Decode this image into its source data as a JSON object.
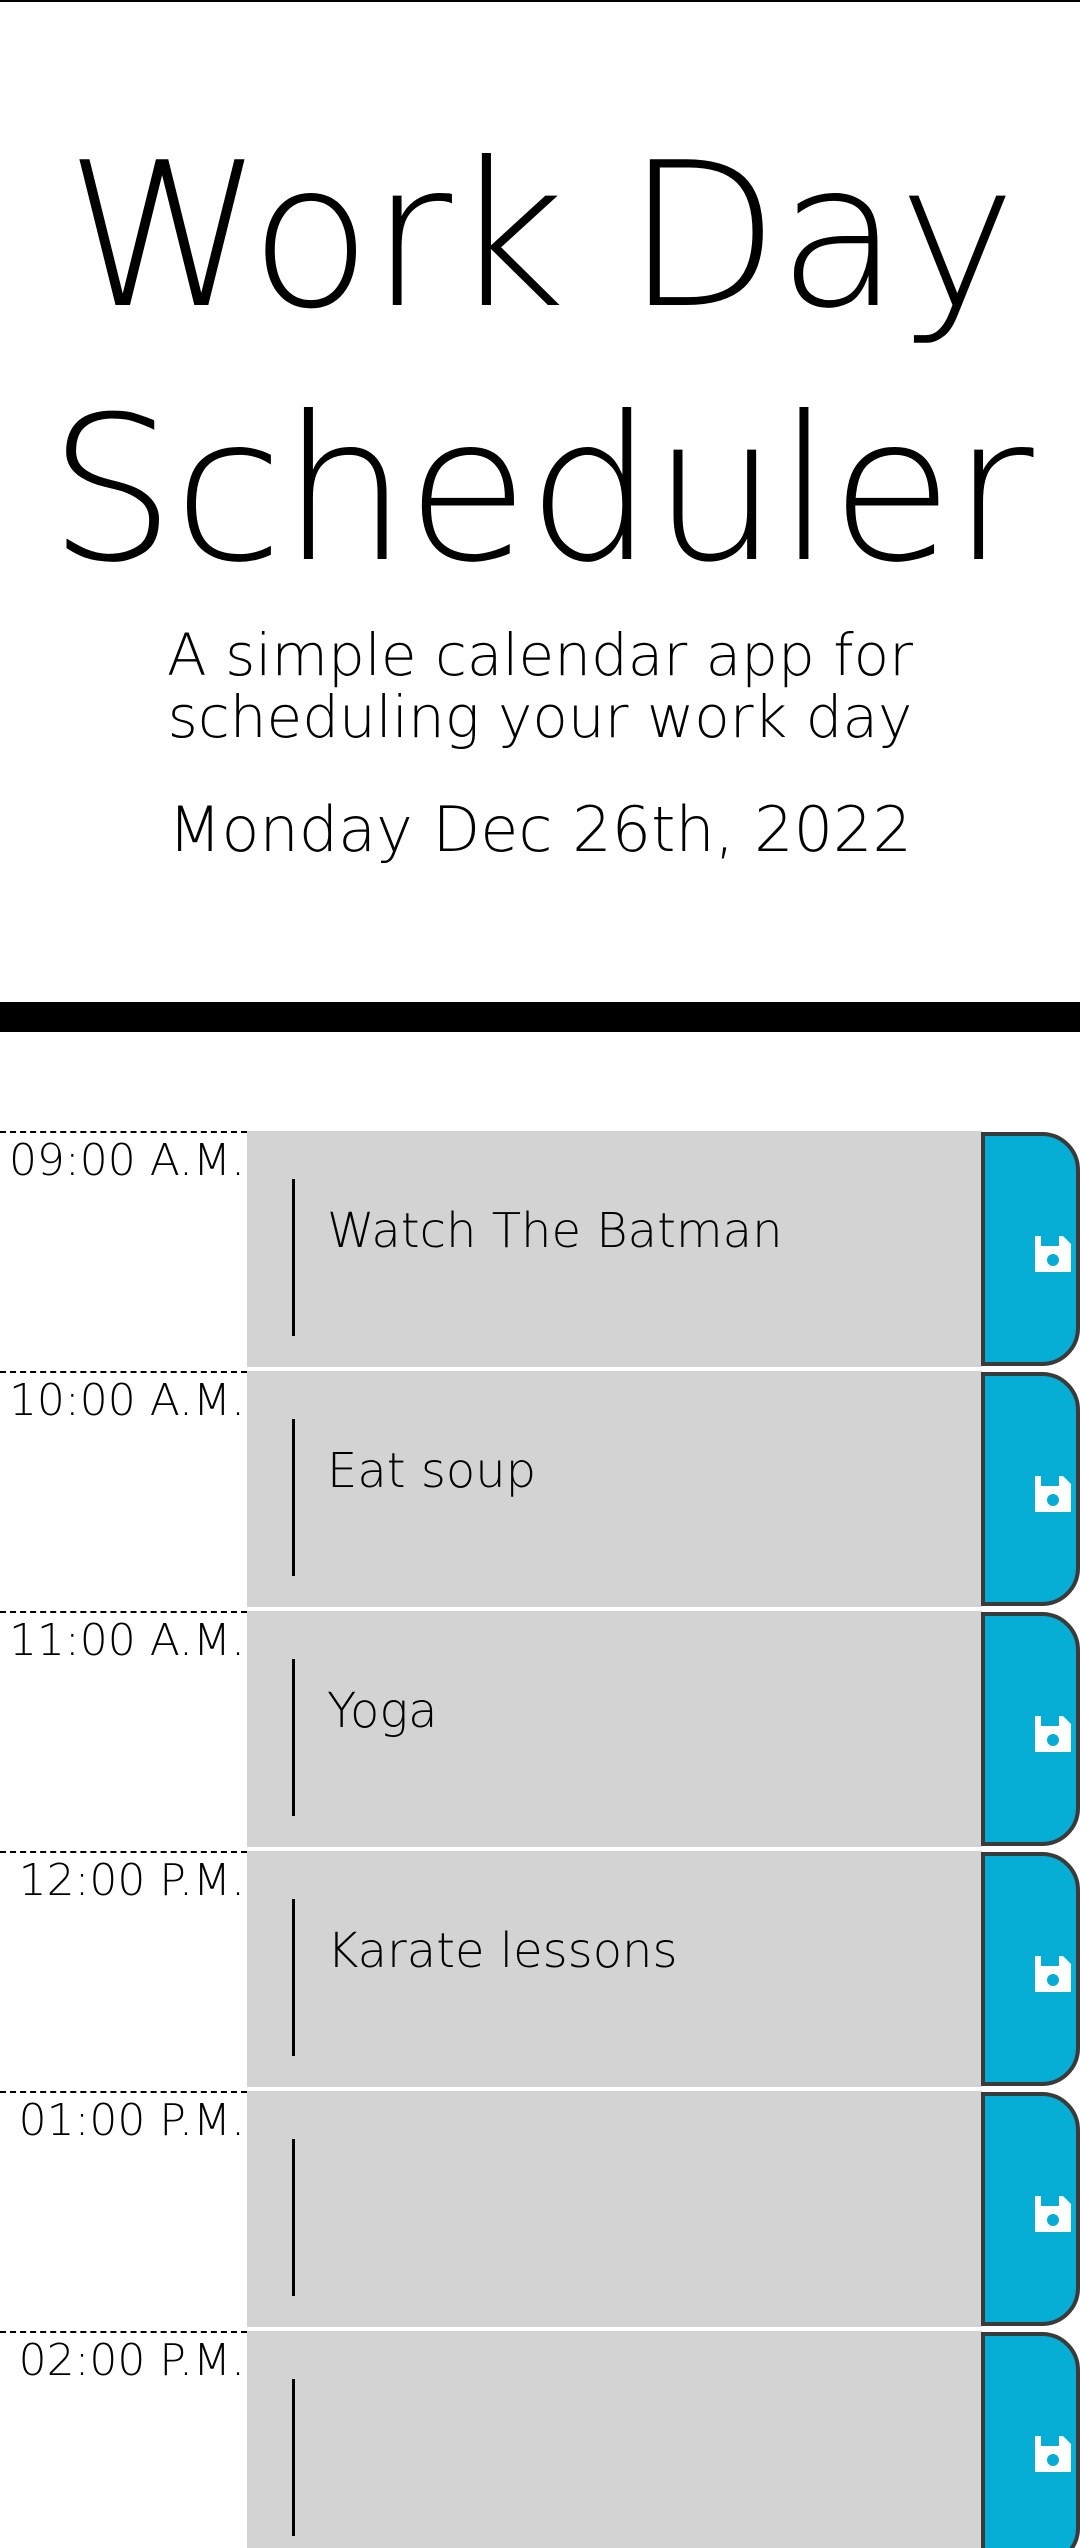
{
  "header": {
    "title": "Work Day Scheduler",
    "subtitle_line1": "A simple calendar app for",
    "subtitle_line2": "scheduling your work day",
    "current_date": "Monday Dec 26th, 2022"
  },
  "colors": {
    "past": "#d3d3d3",
    "save_button": "#06aed5",
    "rule": "#000000"
  },
  "hours": [
    {
      "label": "09:00 A.M.",
      "event": "Watch The Batman",
      "save_icon": "floppy-disk-icon"
    },
    {
      "label": "10:00 A.M.",
      "event": "Eat soup",
      "save_icon": "floppy-disk-icon"
    },
    {
      "label": "11:00 A.M.",
      "event": "Yoga",
      "save_icon": "floppy-disk-icon"
    },
    {
      "label": "12:00 P.M.",
      "event": "Karate lessons",
      "save_icon": "floppy-disk-icon"
    },
    {
      "label": "01:00 P.M.",
      "event": "",
      "save_icon": "floppy-disk-icon"
    },
    {
      "label": "02:00 P.M.",
      "event": "",
      "save_icon": "floppy-disk-icon"
    }
  ]
}
